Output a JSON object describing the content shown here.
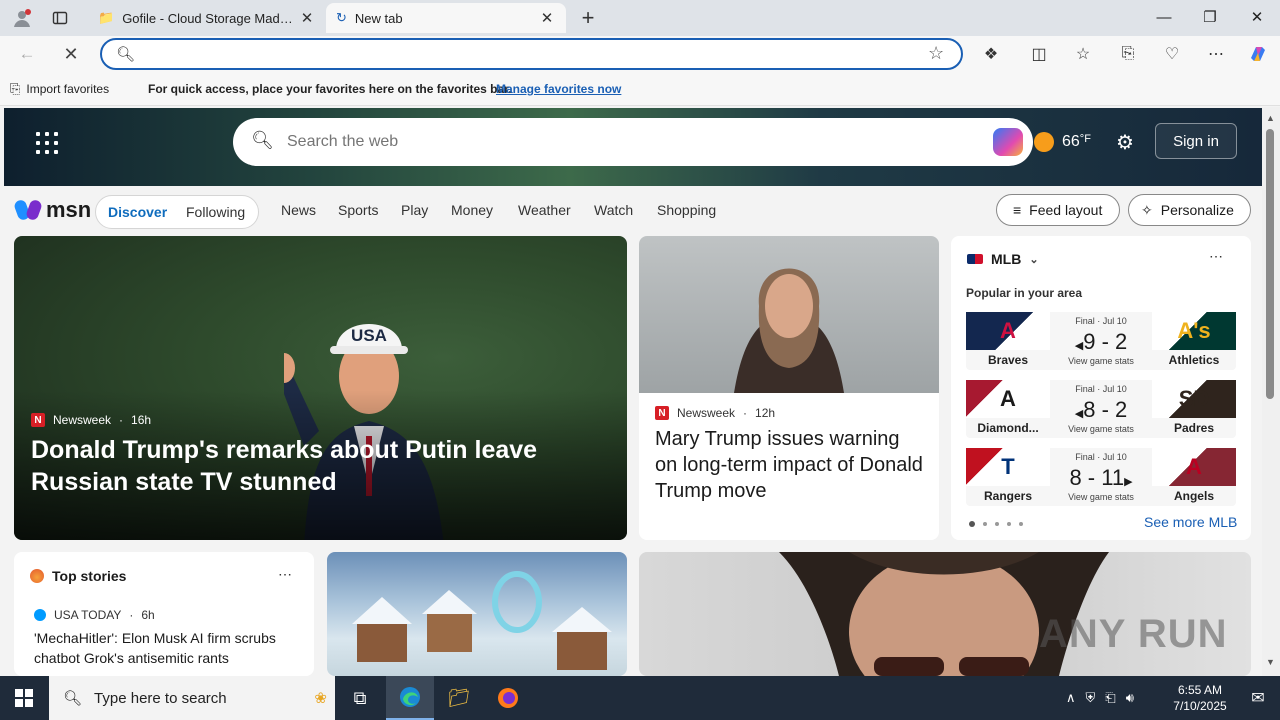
{
  "browser": {
    "tabs": [
      {
        "title": "Gofile - Cloud Storage Made Simple"
      },
      {
        "title": "New tab"
      }
    ],
    "address_value": "",
    "favorites_bar": {
      "import_label": "Import favorites",
      "message": "For quick access, place your favorites here on the favorites bar.",
      "link": "Manage favorites now"
    }
  },
  "msn": {
    "search_placeholder": "Search the web",
    "weather": {
      "temp": "66",
      "unit": "°F"
    },
    "signin_label": "Sign in",
    "logo_text": "msn",
    "pill_tabs": [
      "Discover",
      "Following"
    ],
    "nav_links": [
      "News",
      "Sports",
      "Play",
      "Money",
      "Weather",
      "Watch",
      "Shopping"
    ],
    "feed_layout_label": "Feed layout",
    "personalize_label": "Personalize",
    "main_story": {
      "source": "Newsweek",
      "age": "16h",
      "title": "Donald Trump's remarks about Putin leave Russian state TV stunned",
      "hat_text": "USA"
    },
    "second_story": {
      "source": "Newsweek",
      "age": "12h",
      "title": "Mary Trump issues warning on long-term impact of Donald Trump move"
    },
    "mlb": {
      "title": "MLB",
      "popular": "Popular in your area",
      "games": [
        {
          "status": "Final · Jul 10",
          "score": "9 - 2",
          "stats": "View game stats",
          "left_team": "Braves",
          "right_team": "Athletics",
          "left_logo": "A",
          "right_logo": "A's",
          "left_color": "#13274f",
          "right_color": "#003831",
          "left_fg": "#ce1141",
          "right_fg": "#efb21e"
        },
        {
          "status": "Final · Jul 10",
          "score": "8 - 2",
          "stats": "View game stats",
          "left_team": "Diamond...",
          "right_team": "Padres",
          "left_logo": "A",
          "right_logo": "SD",
          "left_color": "#a71930",
          "right_color": "#2f241d",
          "left_fg": "#1b1b1b",
          "right_fg": "#ffc425"
        },
        {
          "status": "Final · Jul 10",
          "score": "8 - 11",
          "stats": "View game stats",
          "left_team": "Rangers",
          "right_team": "Angels",
          "left_logo": "T",
          "right_logo": "A",
          "left_color": "#003278",
          "right_color": "#862633",
          "left_fg": "#c0111f",
          "right_fg": "#ba0021"
        }
      ],
      "see_more": "See more MLB"
    },
    "top_stories": {
      "title": "Top stories",
      "source": "USA TODAY",
      "age": "6h",
      "headline": "'MechaHitler': Elon Musk AI firm scrubs chatbot Grok's antisemitic rants"
    },
    "watermark": "ANY RUN"
  },
  "taskbar": {
    "search_placeholder": "Type here to search",
    "time": "6:55 AM",
    "date": "7/10/2025"
  },
  "colors": {
    "accent": "#1a5fb4",
    "newsweek_red": "#d71f26",
    "discover_blue": "#0f6cbd"
  }
}
